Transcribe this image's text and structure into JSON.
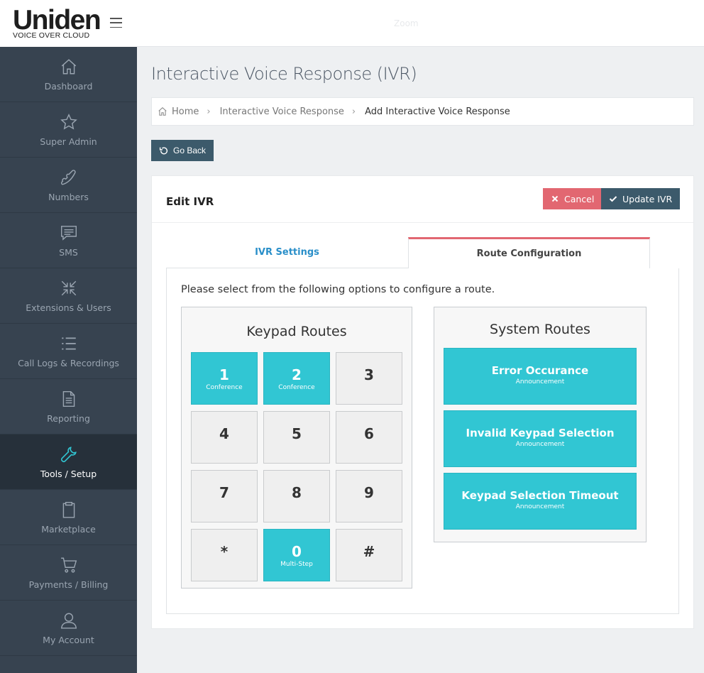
{
  "brand": {
    "name": "Uniden",
    "tagline": "VOICE OVER CLOUD"
  },
  "topbar": {
    "center_text": "Zoom"
  },
  "sidebar": {
    "items": [
      {
        "label": "Dashboard",
        "icon": "home-icon",
        "active": false
      },
      {
        "label": "Super Admin",
        "icon": "star-icon",
        "active": false
      },
      {
        "label": "Numbers",
        "icon": "phone-icon",
        "active": false
      },
      {
        "label": "SMS",
        "icon": "message-icon",
        "active": false
      },
      {
        "label": "Extensions & Users",
        "icon": "compress-icon",
        "active": false
      },
      {
        "label": "Call Logs & Recordings",
        "icon": "list-icon",
        "active": false
      },
      {
        "label": "Reporting",
        "icon": "document-icon",
        "active": false
      },
      {
        "label": "Tools / Setup",
        "icon": "wrench-icon",
        "active": true
      },
      {
        "label": "Marketplace",
        "icon": "clipboard-icon",
        "active": false
      },
      {
        "label": "Payments / Billing",
        "icon": "cart-icon",
        "active": false
      },
      {
        "label": "My Account",
        "icon": "user-icon",
        "active": false
      }
    ]
  },
  "page": {
    "title": "Interactive Voice Response (IVR)"
  },
  "breadcrumb": {
    "home": "Home",
    "section": "Interactive Voice Response",
    "current": "Add Interactive Voice Response"
  },
  "actions": {
    "go_back": "Go Back"
  },
  "panel": {
    "title": "Edit IVR",
    "cancel": "Cancel",
    "update": "Update IVR",
    "tabs": [
      {
        "label": "IVR Settings",
        "active": false
      },
      {
        "label": "Route Configuration",
        "active": true
      }
    ],
    "intro": "Please select from the following options to configure a route."
  },
  "keypad": {
    "title": "Keypad Routes",
    "keys": [
      {
        "num": "1",
        "sub": "Conference"
      },
      {
        "num": "2",
        "sub": "Conference"
      },
      {
        "num": "3",
        "sub": ""
      },
      {
        "num": "4",
        "sub": ""
      },
      {
        "num": "5",
        "sub": ""
      },
      {
        "num": "6",
        "sub": ""
      },
      {
        "num": "7",
        "sub": ""
      },
      {
        "num": "8",
        "sub": ""
      },
      {
        "num": "9",
        "sub": ""
      },
      {
        "num": "*",
        "sub": ""
      },
      {
        "num": "0",
        "sub": "Multi-Step"
      },
      {
        "num": "#",
        "sub": ""
      }
    ]
  },
  "system": {
    "title": "System Routes",
    "items": [
      {
        "name": "Error Occurance",
        "sub": "Announcement"
      },
      {
        "name": "Invalid Keypad Selection",
        "sub": "Announcement"
      },
      {
        "name": "Keypad Selection Timeout",
        "sub": "Announcement"
      }
    ]
  },
  "colors": {
    "sidebar": "#374350",
    "accent": "#31c6d3",
    "danger": "#e26771",
    "primary": "#3c5a6b",
    "link": "#2a8fc9"
  }
}
